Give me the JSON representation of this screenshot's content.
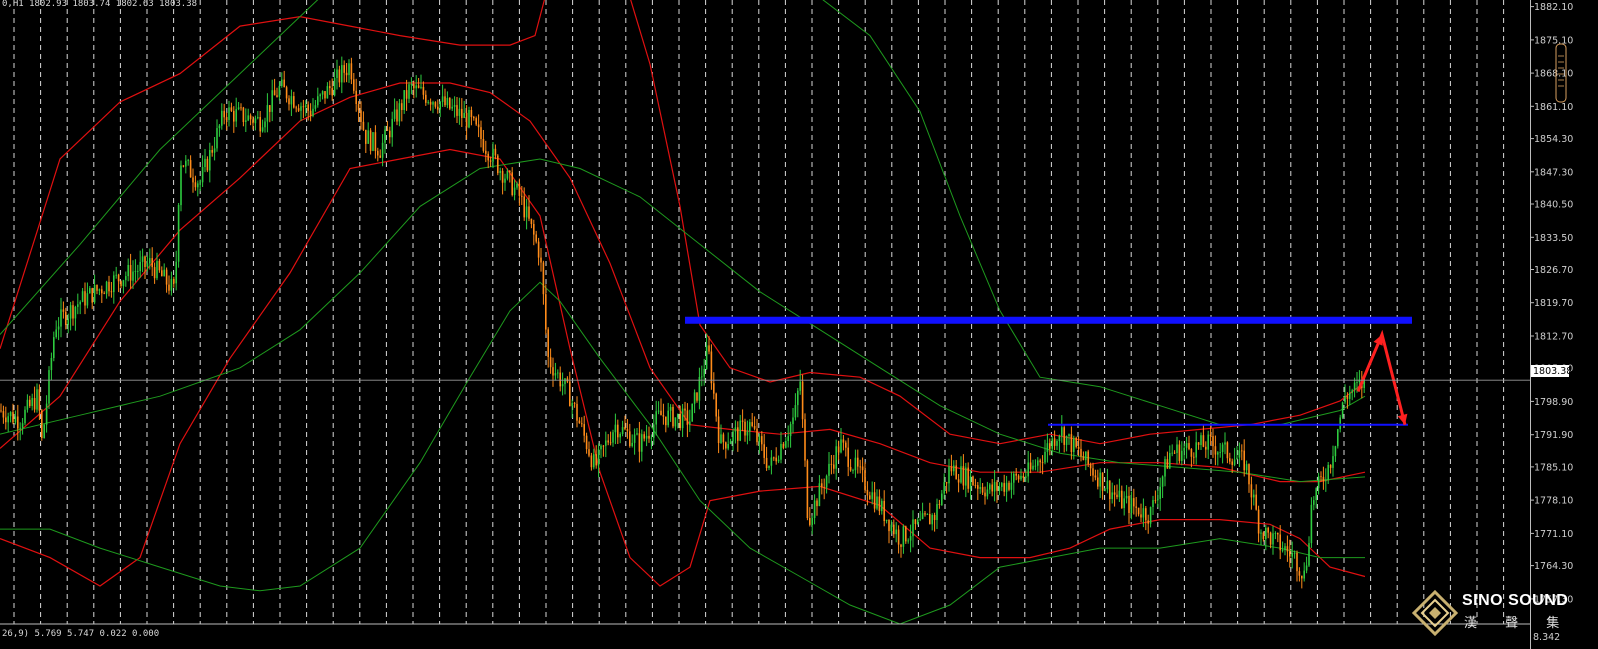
{
  "header": {
    "ohlc": "0,H1  1802.93 1803.74 1802.63 1803.38"
  },
  "indicator": {
    "readout": "26,9) 5.769 5.747 0.022 0.000",
    "axis_label": "8.342"
  },
  "current_price_label": "1803.38",
  "logo": {
    "title": "SINO SOUND",
    "subtitle": "漢 聲 集"
  },
  "colors": {
    "background": "#000000",
    "bull_candle": "#2ecc40",
    "bear_candle": "#ff8c1a",
    "bollinger_red": "#e01010",
    "bollinger_green": "#1e9a1e",
    "resistance": "#1010ff",
    "arrow": "#ff2020",
    "grid": "#ffffff"
  },
  "chart_data": {
    "type": "candlestick",
    "symbol_timeframe": "H1",
    "y_axis": {
      "ticks": [
        1882.1,
        1875.1,
        1868.1,
        1861.1,
        1854.3,
        1847.3,
        1840.5,
        1833.5,
        1826.7,
        1819.7,
        1812.7,
        1805.9,
        1798.9,
        1791.9,
        1785.1,
        1778.1,
        1771.1,
        1764.3,
        1757.3
      ],
      "tick_labels": [
        "1882.10",
        "1875.10",
        "1868.10",
        "1861.10",
        "1854.30",
        "1847.30",
        "1840.50",
        "1833.50",
        "1826.70",
        "1819.70",
        "1812.70",
        "1805.90",
        "1798.90",
        "1791.90",
        "1785.10",
        "1778.10",
        "1771.10",
        "1764.30",
        "1757.30"
      ],
      "range": [
        1752,
        1883.5
      ]
    },
    "x_range": [
      0,
      1530
    ],
    "current_price": 1803.38,
    "horizontal_lines": [
      {
        "name": "resistance-thick",
        "price": 1816.0,
        "x_start": 685,
        "x_end": 1412,
        "width": "thick"
      },
      {
        "name": "support-thin",
        "price": 1794.0,
        "x_start": 1048,
        "x_end": 1408,
        "width": "thin"
      }
    ],
    "arrow_projection": [
      {
        "x": 1358,
        "price": 1801.0
      },
      {
        "x": 1382,
        "price": 1813.0
      },
      {
        "x": 1405,
        "price": 1794.0
      }
    ],
    "price_keyframes": [
      [
        0,
        1797
      ],
      [
        20,
        1795
      ],
      [
        38,
        1800
      ],
      [
        42,
        1790
      ],
      [
        55,
        1815
      ],
      [
        80,
        1820
      ],
      [
        110,
        1824
      ],
      [
        150,
        1828
      ],
      [
        175,
        1822
      ],
      [
        180,
        1850
      ],
      [
        200,
        1845
      ],
      [
        225,
        1860
      ],
      [
        260,
        1858
      ],
      [
        280,
        1865
      ],
      [
        310,
        1860
      ],
      [
        350,
        1870
      ],
      [
        365,
        1855
      ],
      [
        380,
        1852
      ],
      [
        410,
        1865
      ],
      [
        440,
        1862
      ],
      [
        470,
        1858
      ],
      [
        500,
        1848
      ],
      [
        520,
        1842
      ],
      [
        540,
        1830
      ],
      [
        548,
        1808
      ],
      [
        570,
        1800
      ],
      [
        595,
        1785
      ],
      [
        615,
        1794
      ],
      [
        640,
        1790
      ],
      [
        660,
        1796
      ],
      [
        690,
        1795
      ],
      [
        708,
        1810
      ],
      [
        720,
        1790
      ],
      [
        750,
        1794
      ],
      [
        770,
        1785
      ],
      [
        795,
        1796
      ],
      [
        800,
        1804
      ],
      [
        808,
        1774
      ],
      [
        840,
        1790
      ],
      [
        870,
        1780
      ],
      [
        900,
        1770
      ],
      [
        935,
        1775
      ],
      [
        950,
        1785
      ],
      [
        990,
        1780
      ],
      [
        1030,
        1784
      ],
      [
        1060,
        1793
      ],
      [
        1090,
        1785
      ],
      [
        1120,
        1778
      ],
      [
        1150,
        1775
      ],
      [
        1170,
        1788
      ],
      [
        1210,
        1790
      ],
      [
        1245,
        1786
      ],
      [
        1260,
        1772
      ],
      [
        1295,
        1766
      ],
      [
        1305,
        1762
      ],
      [
        1312,
        1778
      ],
      [
        1330,
        1786
      ],
      [
        1345,
        1800
      ],
      [
        1365,
        1803
      ]
    ],
    "bollinger_red_upper": [
      [
        0,
        1810
      ],
      [
        60,
        1850
      ],
      [
        120,
        1862
      ],
      [
        180,
        1868
      ],
      [
        240,
        1878
      ],
      [
        300,
        1880
      ],
      [
        350,
        1878
      ],
      [
        400,
        1876
      ],
      [
        460,
        1874
      ],
      [
        510,
        1874
      ],
      [
        535,
        1876
      ],
      [
        545,
        1884
      ]
    ],
    "bollinger_red_upper_2": [
      [
        630,
        1884
      ],
      [
        650,
        1870
      ],
      [
        680,
        1840
      ],
      [
        700,
        1815
      ],
      [
        730,
        1806
      ],
      [
        770,
        1803
      ],
      [
        810,
        1805
      ],
      [
        860,
        1804
      ],
      [
        900,
        1800
      ],
      [
        950,
        1792
      ],
      [
        1000,
        1790
      ],
      [
        1050,
        1792
      ],
      [
        1100,
        1790
      ],
      [
        1150,
        1792
      ],
      [
        1200,
        1793
      ],
      [
        1250,
        1794
      ],
      [
        1300,
        1796
      ],
      [
        1340,
        1799
      ],
      [
        1365,
        1803
      ]
    ],
    "bollinger_red_mid": [
      [
        0,
        1789
      ],
      [
        60,
        1800
      ],
      [
        120,
        1820
      ],
      [
        180,
        1835
      ],
      [
        240,
        1846
      ],
      [
        300,
        1858
      ],
      [
        350,
        1863
      ],
      [
        400,
        1866
      ],
      [
        450,
        1866
      ],
      [
        490,
        1864
      ],
      [
        530,
        1858
      ],
      [
        570,
        1846
      ],
      [
        610,
        1828
      ],
      [
        650,
        1806
      ],
      [
        690,
        1794
      ],
      [
        730,
        1793
      ],
      [
        780,
        1792
      ],
      [
        830,
        1793
      ],
      [
        880,
        1790
      ],
      [
        930,
        1786
      ],
      [
        980,
        1784
      ],
      [
        1040,
        1784
      ],
      [
        1100,
        1786
      ],
      [
        1160,
        1786
      ],
      [
        1220,
        1785
      ],
      [
        1280,
        1782
      ],
      [
        1320,
        1782
      ],
      [
        1365,
        1784
      ]
    ],
    "bollinger_red_lower": [
      [
        0,
        1770
      ],
      [
        50,
        1766
      ],
      [
        100,
        1760
      ],
      [
        140,
        1766
      ],
      [
        180,
        1790
      ],
      [
        230,
        1808
      ],
      [
        290,
        1826
      ],
      [
        350,
        1848
      ],
      [
        400,
        1850
      ],
      [
        450,
        1852
      ],
      [
        500,
        1850
      ],
      [
        540,
        1838
      ],
      [
        570,
        1810
      ],
      [
        600,
        1784
      ],
      [
        630,
        1766
      ],
      [
        660,
        1760
      ],
      [
        690,
        1764
      ],
      [
        710,
        1778
      ],
      [
        760,
        1780
      ],
      [
        820,
        1781
      ],
      [
        880,
        1777
      ],
      [
        930,
        1768
      ],
      [
        980,
        1766
      ],
      [
        1030,
        1766
      ],
      [
        1070,
        1768
      ],
      [
        1110,
        1772
      ],
      [
        1160,
        1774
      ],
      [
        1220,
        1774
      ],
      [
        1270,
        1773
      ],
      [
        1300,
        1770
      ],
      [
        1330,
        1764
      ],
      [
        1365,
        1762
      ]
    ],
    "bollinger_green_upper": [
      [
        0,
        1813
      ],
      [
        80,
        1832
      ],
      [
        160,
        1852
      ],
      [
        240,
        1868
      ],
      [
        300,
        1880
      ],
      [
        320,
        1884
      ]
    ],
    "bollinger_green_upper_2": [
      [
        820,
        1884
      ],
      [
        870,
        1876
      ],
      [
        920,
        1860
      ],
      [
        960,
        1838
      ],
      [
        1000,
        1818
      ],
      [
        1040,
        1804
      ],
      [
        1100,
        1802
      ],
      [
        1160,
        1798
      ],
      [
        1220,
        1794
      ],
      [
        1280,
        1794
      ],
      [
        1340,
        1797
      ],
      [
        1365,
        1800
      ]
    ],
    "bollinger_green_mid": [
      [
        0,
        1792
      ],
      [
        80,
        1796
      ],
      [
        160,
        1800
      ],
      [
        240,
        1806
      ],
      [
        300,
        1814
      ],
      [
        360,
        1826
      ],
      [
        420,
        1840
      ],
      [
        480,
        1848
      ],
      [
        540,
        1850
      ],
      [
        580,
        1848
      ],
      [
        640,
        1842
      ],
      [
        700,
        1832
      ],
      [
        760,
        1822
      ],
      [
        820,
        1814
      ],
      [
        880,
        1806
      ],
      [
        940,
        1798
      ],
      [
        1000,
        1792
      ],
      [
        1060,
        1788
      ],
      [
        1120,
        1786
      ],
      [
        1180,
        1785
      ],
      [
        1240,
        1784
      ],
      [
        1300,
        1782
      ],
      [
        1365,
        1783
      ]
    ],
    "bollinger_green_lower": [
      [
        0,
        1772
      ],
      [
        50,
        1772
      ],
      [
        100,
        1768
      ],
      [
        160,
        1764
      ],
      [
        220,
        1760
      ],
      [
        260,
        1759
      ],
      [
        300,
        1760
      ],
      [
        360,
        1768
      ],
      [
        420,
        1786
      ],
      [
        470,
        1804
      ],
      [
        510,
        1818
      ],
      [
        540,
        1824
      ],
      [
        560,
        1820
      ],
      [
        600,
        1808
      ],
      [
        650,
        1794
      ],
      [
        700,
        1778
      ],
      [
        750,
        1768
      ],
      [
        800,
        1762
      ],
      [
        850,
        1756
      ],
      [
        900,
        1752
      ],
      [
        950,
        1756
      ],
      [
        1000,
        1764
      ],
      [
        1050,
        1766
      ],
      [
        1100,
        1768
      ],
      [
        1160,
        1768
      ],
      [
        1220,
        1770
      ],
      [
        1280,
        1768
      ],
      [
        1320,
        1766
      ],
      [
        1365,
        1766
      ]
    ]
  }
}
